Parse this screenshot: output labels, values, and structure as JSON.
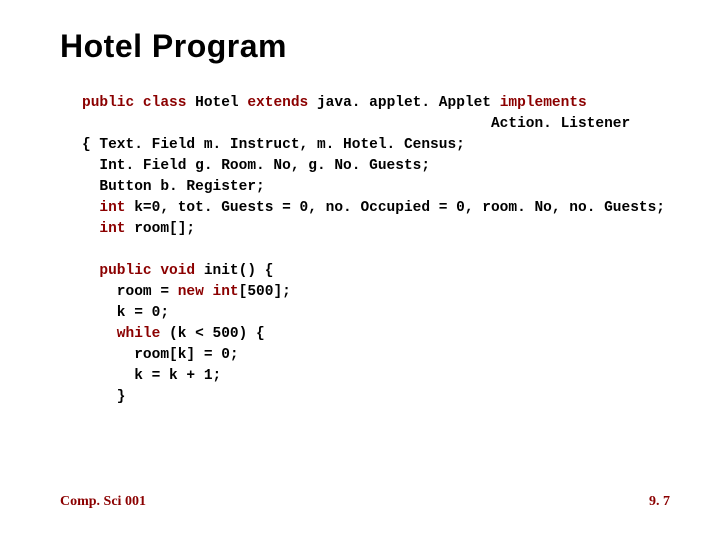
{
  "title": "Hotel Program",
  "code": {
    "l1a": "public class ",
    "l1b": "Hotel ",
    "l1c": "extends ",
    "l1d": "java. applet. Applet ",
    "l1e": "implements",
    "l2": "Action. Listener",
    "l3": "{ Text. Field m. Instruct, m. Hotel. Census;",
    "l4": "  Int. Field g. Room. No, g. No. Guests;",
    "l5": "  Button b. Register;",
    "l6a": "  int ",
    "l6b": "k=0, tot. Guests = 0, no. Occupied = 0, room. No, no. Guests;",
    "l7a": "  int ",
    "l7b": "room[];",
    "l8a": "  public void ",
    "l8b": "init() {",
    "l9a": "    room = ",
    "l9b": "new int",
    "l9c": "[500];",
    "l10": "    k = 0;",
    "l11a": "    while ",
    "l11b": "(k < 500) {",
    "l12": "      room[k] = 0;",
    "l13": "      k = k + 1;",
    "l14": "    }"
  },
  "footer": {
    "left": "Comp. Sci 001",
    "right": "9. 7"
  }
}
